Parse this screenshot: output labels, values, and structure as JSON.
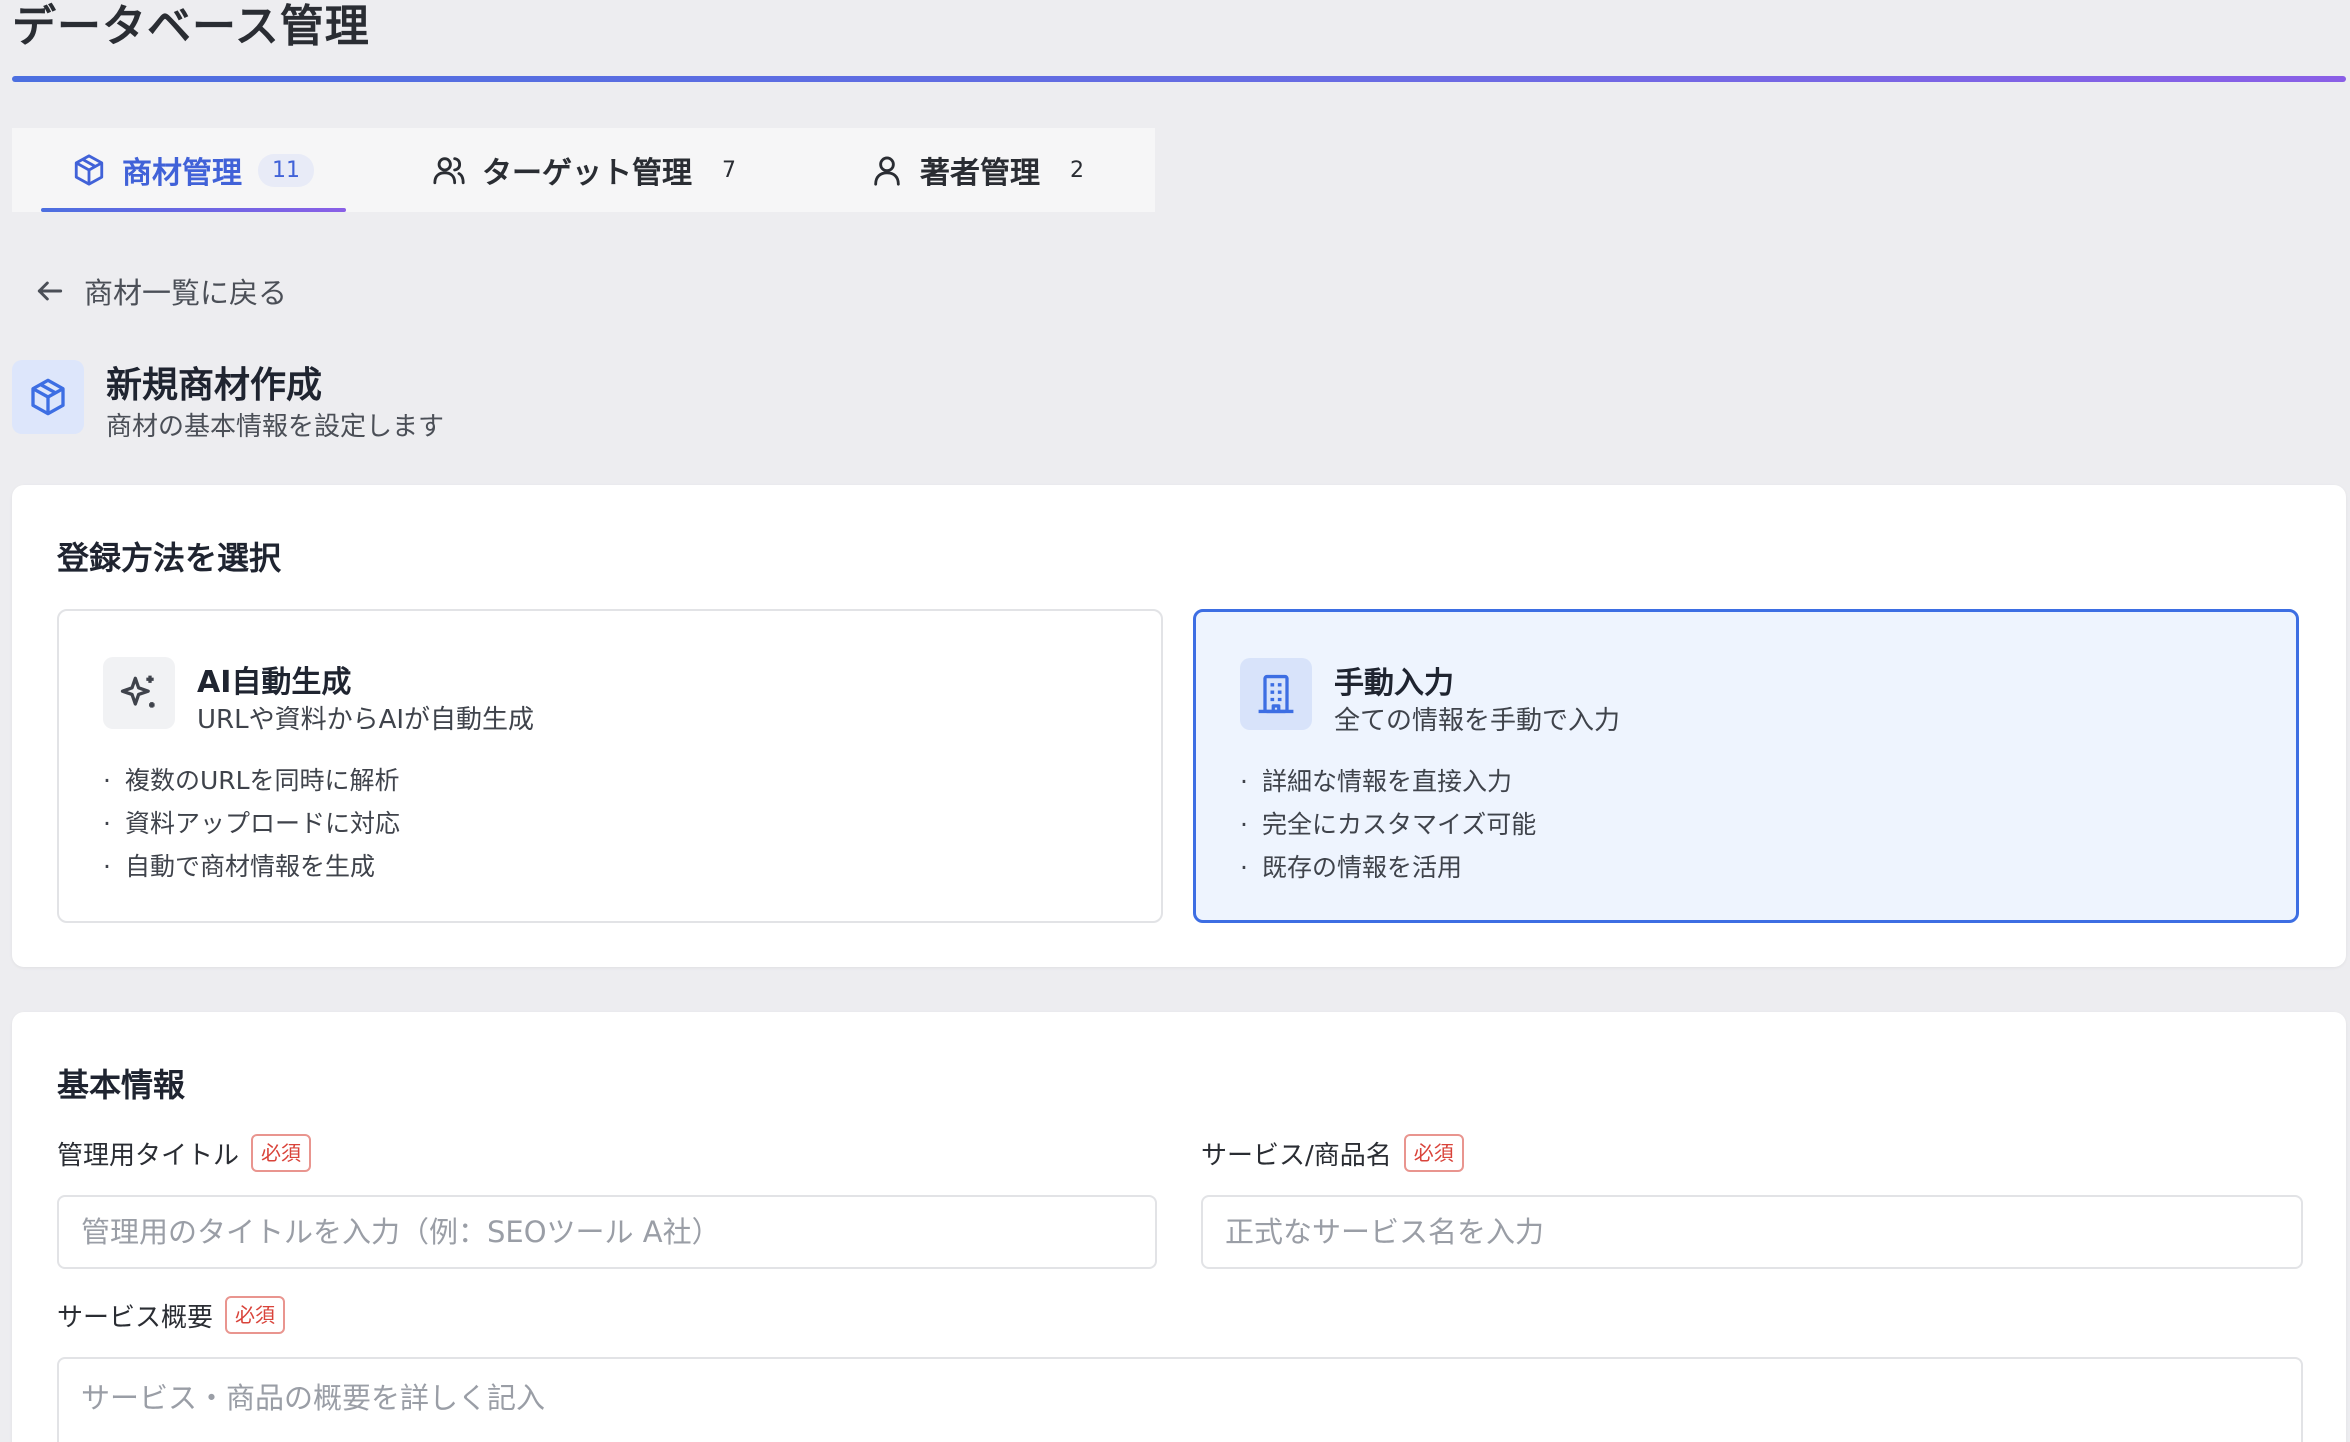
{
  "page": {
    "title": "データベース管理"
  },
  "tabs": [
    {
      "label": "商材管理",
      "count": "11",
      "icon": "box-icon",
      "active": true
    },
    {
      "label": "ターゲット管理",
      "count": "7",
      "icon": "users-icon",
      "active": false
    },
    {
      "label": "著者管理",
      "count": "2",
      "icon": "user-icon",
      "active": false
    }
  ],
  "back": {
    "label": "商材一覧に戻る",
    "icon": "arrow-left-icon"
  },
  "header": {
    "title": "新規商材作成",
    "subtitle": "商材の基本情報を設定します",
    "icon": "box-icon"
  },
  "method": {
    "heading": "登録方法を選択",
    "options": [
      {
        "title": "AI自動生成",
        "subtitle": "URLや資料からAIが自動生成",
        "icon": "sparkle-icon",
        "selected": false,
        "features": [
          "複数のURLを同時に解析",
          "資料アップロードに対応",
          "自動で商材情報を生成"
        ]
      },
      {
        "title": "手動入力",
        "subtitle": "全ての情報を手動で入力",
        "icon": "building-icon",
        "selected": true,
        "features": [
          "詳細な情報を直接入力",
          "完全にカスタマイズ可能",
          "既存の情報を活用"
        ]
      }
    ]
  },
  "basic": {
    "heading": "基本情報",
    "required_label": "必須",
    "fields": {
      "admin_title": {
        "label": "管理用タイトル",
        "placeholder": "管理用のタイトルを入力（例：SEOツール A社）"
      },
      "service_name": {
        "label": "サービス/商品名",
        "placeholder": "正式なサービス名を入力"
      },
      "summary": {
        "label": "サービス概要",
        "placeholder": "サービス・商品の概要を詳しく記入"
      }
    }
  },
  "colors": {
    "accent": "#4162d8",
    "required": "#d9433a",
    "selected_bg": "#eef4fe"
  }
}
